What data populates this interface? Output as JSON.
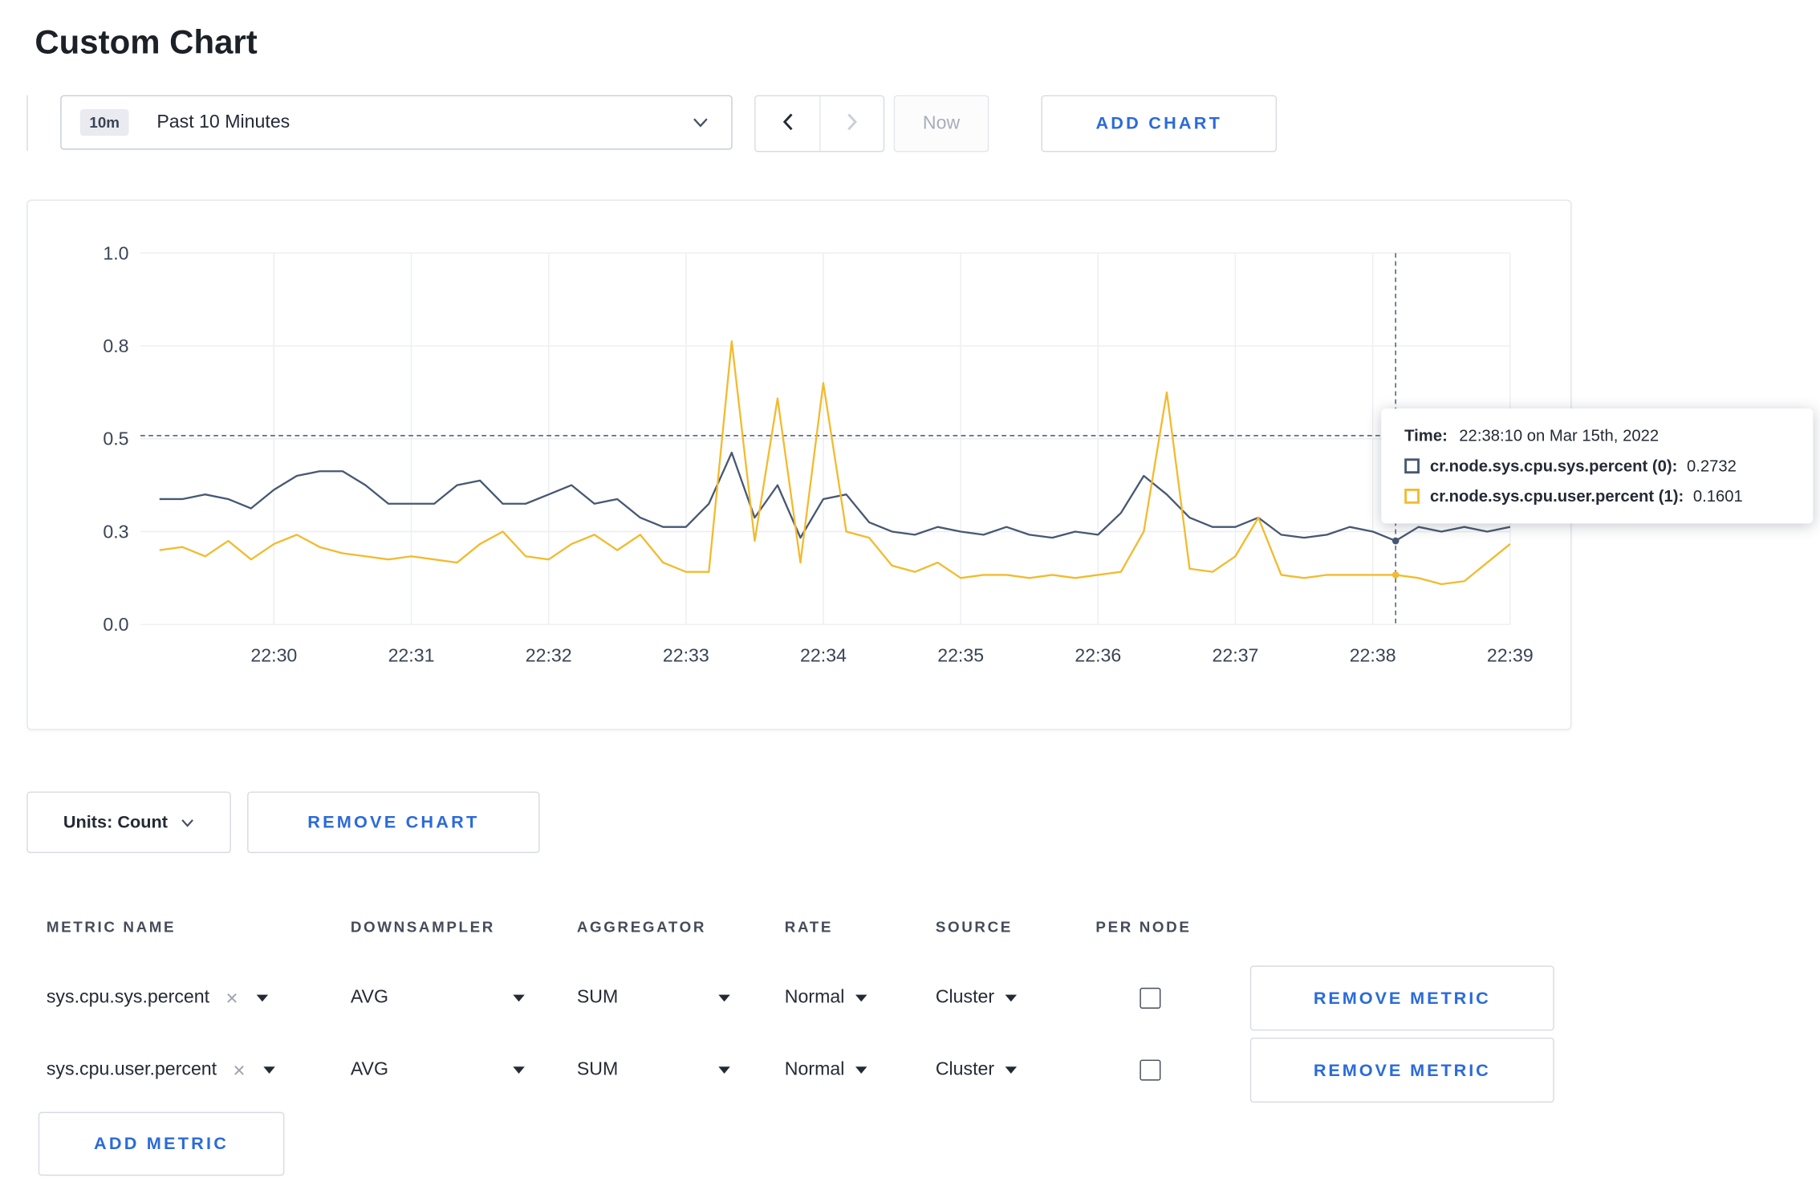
{
  "page": {
    "title": "Custom Chart"
  },
  "toolbar": {
    "time_window": {
      "badge": "10m",
      "label": "Past 10 Minutes"
    },
    "now_label": "Now",
    "add_chart_label": "ADD CHART"
  },
  "tooltip": {
    "time_label": "Time:",
    "time_value": "22:38:10 on Mar 15th, 2022",
    "rows": [
      {
        "label": "cr.node.sys.cpu.sys.percent (0):",
        "value": "0.2732"
      },
      {
        "label": "cr.node.sys.cpu.user.percent (1):",
        "value": "0.1601"
      }
    ]
  },
  "chart_data": {
    "type": "line",
    "title": "",
    "xlabel": "",
    "ylabel": "",
    "grid": true,
    "legend_position": "tooltip-only",
    "x_ticks": [
      "22:30",
      "22:31",
      "22:32",
      "22:33",
      "22:34",
      "22:35",
      "22:36",
      "22:37",
      "22:38",
      "22:39"
    ],
    "y_ticks": [
      0,
      0.3,
      0.5,
      0.8,
      1.0
    ],
    "y_tick_labels": [
      "0.0",
      "0.3",
      "0.5",
      "0.8",
      "1.0"
    ],
    "ylim": [
      0,
      1.0
    ],
    "start_time": "22:29:10",
    "interval_seconds": 10,
    "points_before_first_tick": 5,
    "crosshair_index": 54,
    "crosshair_time": "22:38:10",
    "crosshair_value": 0.51,
    "series": [
      {
        "name": "cr.node.sys.cpu.sys.percent",
        "color": "#475872",
        "values": [
          0.37,
          0.37,
          0.38,
          0.37,
          0.35,
          0.39,
          0.42,
          0.43,
          0.43,
          0.4,
          0.36,
          0.36,
          0.36,
          0.4,
          0.41,
          0.36,
          0.36,
          0.38,
          0.4,
          0.36,
          0.37,
          0.33,
          0.31,
          0.31,
          0.36,
          0.47,
          0.33,
          0.4,
          0.28,
          0.37,
          0.38,
          0.32,
          0.3,
          0.29,
          0.31,
          0.3,
          0.29,
          0.31,
          0.29,
          0.28,
          0.3,
          0.29,
          0.34,
          0.42,
          0.38,
          0.33,
          0.31,
          0.31,
          0.33,
          0.29,
          0.28,
          0.29,
          0.31,
          0.3,
          0.27,
          0.31,
          0.3,
          0.31,
          0.3,
          0.31
        ]
      },
      {
        "name": "cr.node.sys.cpu.user.percent",
        "color": "#f2bb2e",
        "values": [
          0.24,
          0.25,
          0.22,
          0.27,
          0.21,
          0.26,
          0.29,
          0.25,
          0.23,
          0.22,
          0.21,
          0.22,
          0.21,
          0.2,
          0.26,
          0.3,
          0.22,
          0.21,
          0.26,
          0.29,
          0.24,
          0.29,
          0.2,
          0.17,
          0.17,
          0.81,
          0.27,
          0.63,
          0.2,
          0.68,
          0.3,
          0.28,
          0.19,
          0.17,
          0.2,
          0.15,
          0.16,
          0.16,
          0.15,
          0.16,
          0.15,
          0.16,
          0.17,
          0.3,
          0.65,
          0.18,
          0.17,
          0.22,
          0.33,
          0.16,
          0.15,
          0.16,
          0.16,
          0.16,
          0.16,
          0.15,
          0.13,
          0.14,
          0.2,
          0.26
        ]
      }
    ]
  },
  "controls": {
    "units_label": "Units: Count",
    "remove_chart_label": "REMOVE CHART",
    "add_metric_label": "ADD METRIC"
  },
  "metrics_table": {
    "headers": [
      "METRIC NAME",
      "DOWNSAMPLER",
      "AGGREGATOR",
      "RATE",
      "SOURCE",
      "PER NODE"
    ],
    "remove_metric_label": "REMOVE METRIC",
    "rows": [
      {
        "metric": "sys.cpu.sys.percent",
        "downsampler": "AVG",
        "aggregator": "SUM",
        "rate": "Normal",
        "source": "Cluster",
        "per_node_checked": false
      },
      {
        "metric": "sys.cpu.user.percent",
        "downsampler": "AVG",
        "aggregator": "SUM",
        "rate": "Normal",
        "source": "Cluster",
        "per_node_checked": false
      }
    ]
  }
}
